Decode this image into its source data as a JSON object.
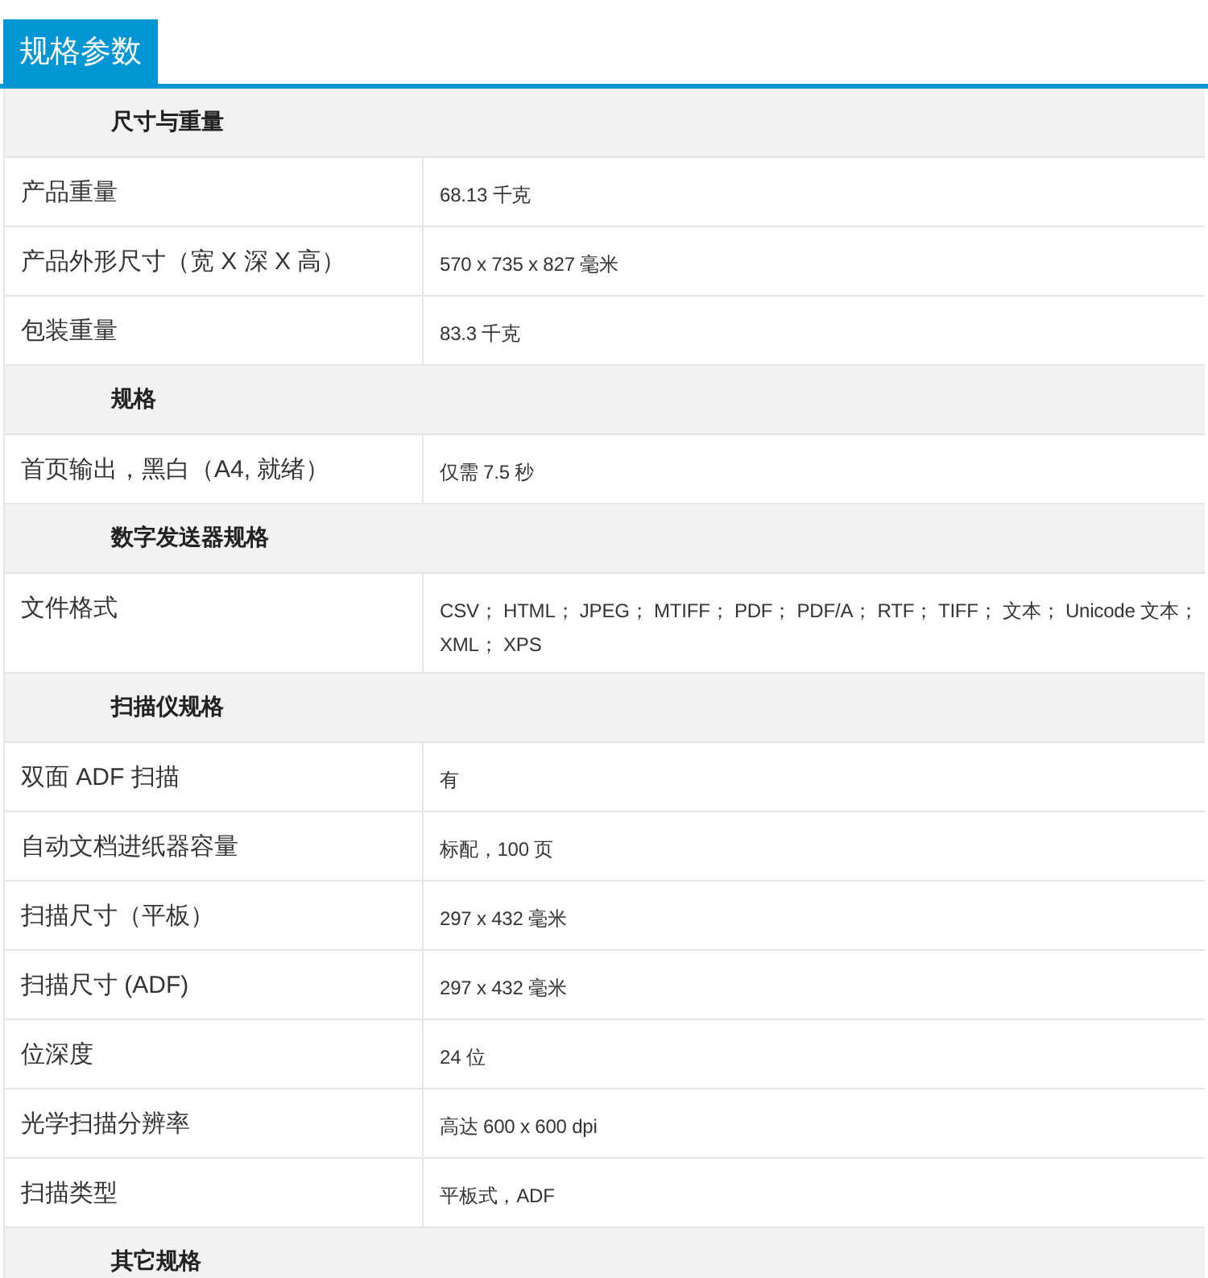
{
  "tab": {
    "label": "规格参数",
    "selected": true
  },
  "sections": [
    {
      "title": "尺寸与重量",
      "rows": [
        {
          "label": "产品重量",
          "value": "68.13 千克"
        },
        {
          "label": "产品外形尺寸（宽 X 深 X 高）",
          "value": "570 x 735 x 827 毫米"
        },
        {
          "label": "包装重量",
          "value": "83.3 千克"
        }
      ]
    },
    {
      "title": "规格",
      "rows": [
        {
          "label": "首页输出，黑白（A4, 就绪）",
          "value": "仅需 7.5 秒"
        }
      ]
    },
    {
      "title": "数字发送器规格",
      "rows": [
        {
          "label": "文件格式",
          "value": "CSV； HTML； JPEG； MTIFF； PDF； PDF/A； RTF； TIFF； 文本； Unicode 文本； XML； XPS"
        }
      ]
    },
    {
      "title": "扫描仪规格",
      "rows": [
        {
          "label": "双面 ADF 扫描",
          "value": "有"
        },
        {
          "label": "自动文档进纸器容量",
          "value": "标配，100 页"
        },
        {
          "label": "扫描尺寸（平板）",
          "value": "297 x 432 毫米"
        },
        {
          "label": "扫描尺寸 (ADF)",
          "value": "297 x 432 毫米"
        },
        {
          "label": "位深度",
          "value": "24 位"
        },
        {
          "label": "光学扫描分辨率",
          "value": "高达 600 x 600 dpi"
        },
        {
          "label": "扫描类型",
          "value": "平板式，ADF"
        }
      ]
    },
    {
      "title": "其它规格"
    }
  ]
}
